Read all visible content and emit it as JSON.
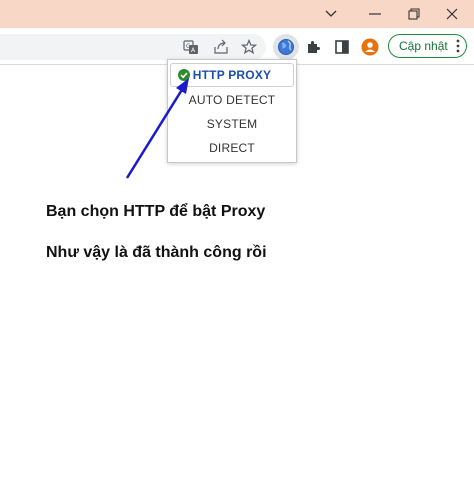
{
  "window": {
    "minimize_icon": "chevron-down-icon",
    "restore_icon": "restore-icon",
    "close_icon": "close-icon"
  },
  "toolbar": {
    "update_button_label": "Cập nhật",
    "accent_green": "#1e8e3e"
  },
  "proxy_menu": {
    "items": [
      {
        "label": "HTTP PROXY",
        "selected": true
      },
      {
        "label": "AUTO DETECT",
        "selected": false
      },
      {
        "label": "SYSTEM",
        "selected": false
      },
      {
        "label": "DIRECT",
        "selected": false
      }
    ],
    "selected_color": "#1a4fa8"
  },
  "annotation": {
    "arrow_color": "#1a1acc",
    "line1": "Bạn chọn HTTP để bật Proxy",
    "line2": "Như vậy là đã thành công rồi"
  }
}
